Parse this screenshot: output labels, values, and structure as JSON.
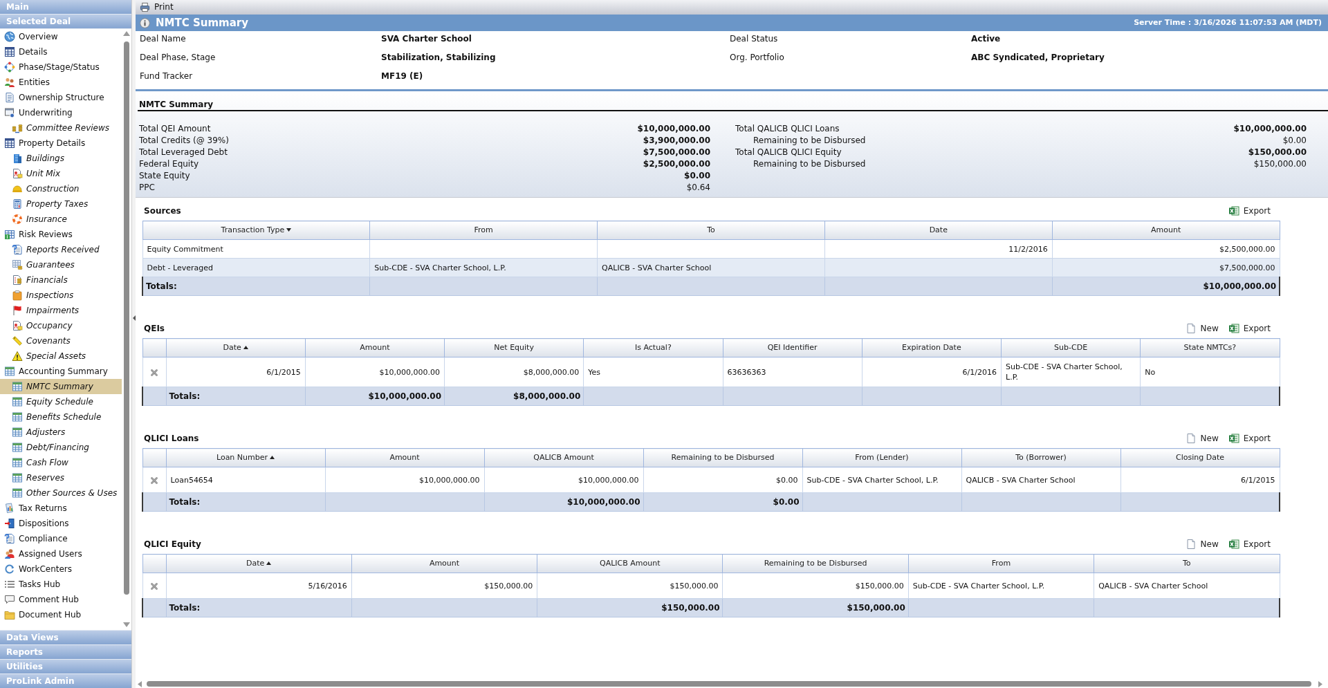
{
  "sidebar": {
    "headers": [
      {
        "label": "Main"
      },
      {
        "label": "Selected Deal"
      }
    ],
    "items": [
      {
        "label": "Overview",
        "selected": false
      },
      {
        "label": "Details",
        "selected": false
      },
      {
        "label": "Phase/Stage/Status",
        "selected": false
      },
      {
        "label": "Entities",
        "selected": false
      },
      {
        "label": "Ownership Structure",
        "selected": false
      },
      {
        "label": "Underwriting",
        "selected": false,
        "children": [
          {
            "label": "Committee Reviews",
            "selected": false
          }
        ]
      },
      {
        "label": "Property Details",
        "selected": false,
        "children": [
          {
            "label": "Buildings",
            "selected": false
          },
          {
            "label": "Unit Mix",
            "selected": false
          },
          {
            "label": "Construction",
            "selected": false
          },
          {
            "label": "Property Taxes",
            "selected": false
          },
          {
            "label": "Insurance",
            "selected": false
          }
        ]
      },
      {
        "label": "Risk Reviews",
        "selected": false,
        "children": [
          {
            "label": "Reports Received",
            "selected": false
          },
          {
            "label": "Guarantees",
            "selected": false
          },
          {
            "label": "Financials",
            "selected": false
          },
          {
            "label": "Inspections",
            "selected": false
          },
          {
            "label": "Impairments",
            "selected": false
          },
          {
            "label": "Occupancy",
            "selected": false
          },
          {
            "label": "Covenants",
            "selected": false
          },
          {
            "label": "Special Assets",
            "selected": false
          }
        ]
      },
      {
        "label": "Accounting Summary",
        "selected": false,
        "children": [
          {
            "label": "NMTC Summary",
            "selected": true
          },
          {
            "label": "Equity Schedule",
            "selected": false
          },
          {
            "label": "Benefits Schedule",
            "selected": false
          },
          {
            "label": "Adjusters",
            "selected": false
          },
          {
            "label": "Debt/Financing",
            "selected": false
          },
          {
            "label": "Cash Flow",
            "selected": false
          },
          {
            "label": "Reserves",
            "selected": false
          },
          {
            "label": "Other Sources & Uses",
            "selected": false
          }
        ]
      },
      {
        "label": "Tax Returns",
        "selected": false
      },
      {
        "label": "Dispositions",
        "selected": false
      },
      {
        "label": "Compliance",
        "selected": false
      },
      {
        "label": "Assigned Users",
        "selected": false
      },
      {
        "label": "WorkCenters",
        "selected": false
      },
      {
        "label": "Tasks Hub",
        "selected": false
      },
      {
        "label": "Comment Hub",
        "selected": false
      },
      {
        "label": "Document Hub",
        "selected": false
      }
    ],
    "footer_headers": [
      {
        "label": "Data Views"
      },
      {
        "label": "Reports"
      },
      {
        "label": "Utilities"
      },
      {
        "label": "ProLink Admin"
      }
    ]
  },
  "toolbar": {
    "print_label": "Print"
  },
  "title_bar": {
    "title": "NMTC Summary",
    "server_time": "Server Time : 3/16/2026 11:07:53 AM (MDT)"
  },
  "deal_info": {
    "rows": [
      {
        "fields": [
          {
            "label": "Deal Name",
            "value": "SVA Charter School"
          },
          {
            "label": "Deal Status",
            "value": "Active"
          }
        ]
      },
      {
        "fields": [
          {
            "label": "Deal Phase, Stage",
            "value": "Stabilization, Stabilizing"
          },
          {
            "label": "Org. Portfolio",
            "value": "ABC Syndicated, Proprietary"
          }
        ]
      },
      {
        "fields": [
          {
            "label": "Fund Tracker",
            "value": "MF19 (E)"
          }
        ]
      }
    ]
  },
  "nmtc_summary": {
    "title": "NMTC Summary",
    "left": [
      {
        "label": "Total QEI Amount",
        "value": "$10,000,000.00",
        "bold": true
      },
      {
        "label": "Total Credits (@ 39%)",
        "value": "$3,900,000.00",
        "bold": true
      },
      {
        "label": "Total Leveraged Debt",
        "value": "$7,500,000.00",
        "bold": true
      },
      {
        "label": "Federal Equity",
        "value": "$2,500,000.00",
        "bold": true
      },
      {
        "label": "State Equity",
        "value": "$0.00",
        "bold": true
      },
      {
        "label": "PPC",
        "value": "$0.64",
        "bold": false
      }
    ],
    "right": [
      {
        "label": "Total QALICB QLICI Loans",
        "value": "$10,000,000.00",
        "bold": true,
        "children": [
          {
            "label": "Remaining to be Disbursed",
            "value": "$0.00",
            "bold": false
          }
        ]
      },
      {
        "label": "Total QALICB QLICI Equity",
        "value": "$150,000.00",
        "bold": true,
        "children": [
          {
            "label": "Remaining to be Disbursed",
            "value": "$150,000.00",
            "bold": false
          }
        ]
      }
    ]
  },
  "tables": [
    {
      "title": "Sources",
      "deletable": false,
      "actions": [
        {
          "kind": "export",
          "label": "Export"
        }
      ],
      "columns": [
        {
          "label": "Transaction Type",
          "kind": "text",
          "sorted": true,
          "ascending": false
        },
        {
          "label": "From",
          "kind": "text",
          "sorted": false
        },
        {
          "label": "To",
          "kind": "text",
          "sorted": false
        },
        {
          "label": "Date",
          "kind": "date",
          "sorted": false
        },
        {
          "label": "Amount",
          "kind": "money",
          "sorted": false
        }
      ],
      "rows": [
        {
          "cells": [
            "Equity Commitment",
            null,
            null,
            "11/2/2016",
            "$2,500,000.00"
          ]
        },
        {
          "cells": [
            "Debt - Leveraged",
            "Sub-CDE - SVA Charter School, L.P.",
            "QALICB - SVA Charter School",
            null,
            "$7,500,000.00"
          ]
        }
      ],
      "totals": {
        "label": "Totals:",
        "cells": [
          null,
          null,
          null,
          "$10,000,000.00"
        ]
      }
    },
    {
      "title": "QEIs",
      "deletable": true,
      "actions": [
        {
          "kind": "new",
          "label": "New"
        },
        {
          "kind": "export",
          "label": "Export"
        }
      ],
      "columns": [
        {
          "label": "Date",
          "kind": "date",
          "sorted": true,
          "ascending": true
        },
        {
          "label": "Amount",
          "kind": "money",
          "sorted": false
        },
        {
          "label": "Net Equity",
          "kind": "money",
          "sorted": false
        },
        {
          "label": "Is Actual?",
          "kind": "text",
          "sorted": false
        },
        {
          "label": "QEI Identifier",
          "kind": "text",
          "sorted": false
        },
        {
          "label": "Expiration Date",
          "kind": "date",
          "sorted": false
        },
        {
          "label": "Sub-CDE",
          "kind": "text",
          "sorted": false
        },
        {
          "label": "State NMTCs?",
          "kind": "text",
          "sorted": false
        }
      ],
      "rows": [
        {
          "cells": [
            "6/1/2015",
            "$10,000,000.00",
            "$8,000,000.00",
            "Yes",
            "63636363",
            "6/1/2016",
            "Sub-CDE - SVA Charter School, L.P.",
            "No"
          ]
        }
      ],
      "totals": {
        "label": "Totals:",
        "cells": [
          "$10,000,000.00",
          "$8,000,000.00",
          null,
          null,
          null,
          null,
          null
        ]
      }
    },
    {
      "title": "QLICI Loans",
      "deletable": true,
      "actions": [
        {
          "kind": "new",
          "label": "New"
        },
        {
          "kind": "export",
          "label": "Export"
        }
      ],
      "columns": [
        {
          "label": "Loan Number",
          "kind": "text",
          "sorted": true,
          "ascending": true
        },
        {
          "label": "Amount",
          "kind": "money",
          "sorted": false
        },
        {
          "label": "QALICB Amount",
          "kind": "money",
          "sorted": false
        },
        {
          "label": "Remaining to be Disbursed",
          "kind": "money",
          "sorted": false
        },
        {
          "label": "From (Lender)",
          "kind": "text",
          "sorted": false
        },
        {
          "label": "To (Borrower)",
          "kind": "text",
          "sorted": false
        },
        {
          "label": "Closing Date",
          "kind": "date",
          "sorted": false
        }
      ],
      "rows": [
        {
          "cells": [
            "Loan54654",
            "$10,000,000.00",
            "$10,000,000.00",
            "$0.00",
            "Sub-CDE - SVA Charter School, L.P.",
            "QALICB - SVA Charter School",
            "6/1/2015"
          ]
        }
      ],
      "totals": {
        "label": "Totals:",
        "cells": [
          null,
          "$10,000,000.00",
          "$0.00",
          null,
          null,
          null
        ]
      }
    },
    {
      "title": "QLICI Equity",
      "deletable": true,
      "actions": [
        {
          "kind": "new",
          "label": "New"
        },
        {
          "kind": "export",
          "label": "Export"
        }
      ],
      "columns": [
        {
          "label": "Date",
          "kind": "date",
          "sorted": true,
          "ascending": true
        },
        {
          "label": "Amount",
          "kind": "money",
          "sorted": false
        },
        {
          "label": "QALICB Amount",
          "kind": "money",
          "sorted": false
        },
        {
          "label": "Remaining to be Disbursed",
          "kind": "money",
          "sorted": false
        },
        {
          "label": "From",
          "kind": "text",
          "sorted": false
        },
        {
          "label": "To",
          "kind": "text",
          "sorted": false
        }
      ],
      "rows": [
        {
          "cells": [
            "5/16/2016",
            "$150,000.00",
            "$150,000.00",
            "$150,000.00",
            "Sub-CDE - SVA Charter School, L.P.",
            "QALICB - SVA Charter School"
          ]
        }
      ],
      "totals": {
        "label": "Totals:",
        "cells": [
          null,
          "$150,000.00",
          "$150,000.00",
          null,
          null
        ]
      }
    }
  ]
}
